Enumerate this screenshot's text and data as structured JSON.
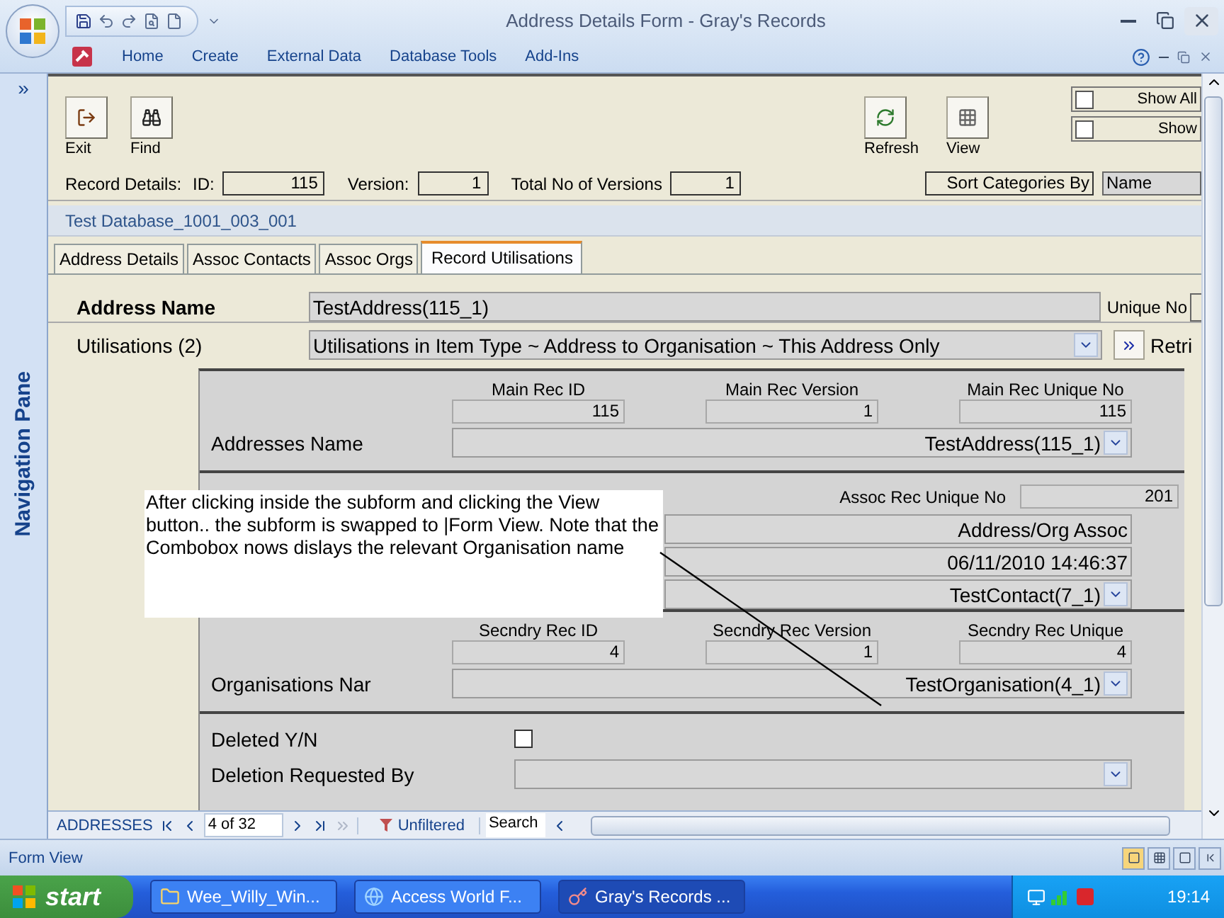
{
  "window": {
    "title": "Address Details Form - Gray's Records"
  },
  "ribbon_tabs": [
    "Home",
    "Create",
    "External Data",
    "Database Tools",
    "Add-Ins"
  ],
  "navigation_pane": {
    "toggle": "»",
    "label": "Navigation Pane"
  },
  "toolbar": {
    "left": [
      {
        "kind": "exit",
        "label": "Exit"
      },
      {
        "kind": "find",
        "label": "Find"
      }
    ],
    "right": [
      {
        "kind": "refresh",
        "label": "Refresh"
      },
      {
        "kind": "view",
        "label": "View"
      }
    ]
  },
  "filters": [
    {
      "label": "Show All",
      "checked": false
    },
    {
      "label": "Show",
      "checked": false
    }
  ],
  "record_details": {
    "label": "Record Details:",
    "fields": [
      {
        "label": "ID:",
        "value": "115"
      },
      {
        "label": "Version:",
        "value": "1"
      },
      {
        "label": "Total No of Versions",
        "value": "1"
      }
    ],
    "sort_label": "Sort Categories By",
    "sort_value": "Name"
  },
  "database_name": "Test Database_1001_003_001",
  "tabs": [
    {
      "label": "Address Details",
      "selected": false
    },
    {
      "label": "Assoc Contacts",
      "selected": false
    },
    {
      "label": "Assoc Orgs",
      "selected": false
    },
    {
      "label": "Record Utilisations",
      "selected": true
    }
  ],
  "address_name": {
    "label": "Address Name",
    "value": "TestAddress(115_1)",
    "unique_label": "Unique No"
  },
  "utilisations": {
    "label": "Utilisations (2)",
    "value": "Utilisations in Item Type ~ Address to Organisation ~ This Address Only",
    "retrieve_label": "Retri"
  },
  "subform": {
    "sections": [
      {
        "kind": "record",
        "columns": [
          {
            "label": "Main Rec ID",
            "value": "115"
          },
          {
            "label": "Main Rec Version",
            "value": "1"
          },
          {
            "label": "Main Rec Unique No",
            "value": "115"
          }
        ],
        "name_label": "Addresses Name",
        "name_value": "TestAddress(115_1)"
      },
      {
        "kind": "assoc",
        "unique_label": "Assoc Rec Unique No",
        "unique_value": "201",
        "rows": [
          {
            "kind": "text",
            "value": "Address/Org Assoc"
          },
          {
            "kind": "text",
            "value": "06/11/2010 14:46:37"
          },
          {
            "kind": "combo",
            "value": "TestContact(7_1)"
          }
        ]
      },
      {
        "kind": "record",
        "columns": [
          {
            "label": "Secndry Rec ID",
            "value": "4"
          },
          {
            "label": "Secndry Rec Version",
            "value": "1"
          },
          {
            "label": "Secndry Rec Unique",
            "value": "4"
          }
        ],
        "name_label": "Organisations Nar",
        "name_value": "TestOrganisation(4_1)"
      },
      {
        "kind": "deletion",
        "deleted_label": "Deleted Y/N",
        "deleted": false,
        "requested_label": "Deletion Requested By"
      }
    ]
  },
  "annotation": {
    "text": "After clicking inside the subform and clicking the View button.. the subform is swapped to |Form View. Note that the Combobox nows dislays the relevant Organisation name"
  },
  "record_nav": {
    "table": "ADDRESSES",
    "position": "4 of 32",
    "filter": "Unfiltered",
    "search": "Search"
  },
  "status_bar": {
    "text": "Form View"
  },
  "taskbar": {
    "start": "start",
    "items": [
      {
        "kind": "folder",
        "label": "Wee_Willy_Win...",
        "selected": false
      },
      {
        "kind": "browser",
        "label": "Access World F...",
        "selected": false
      },
      {
        "kind": "access",
        "label": "Gray's Records ...",
        "selected": true
      }
    ],
    "clock": "19:14"
  }
}
